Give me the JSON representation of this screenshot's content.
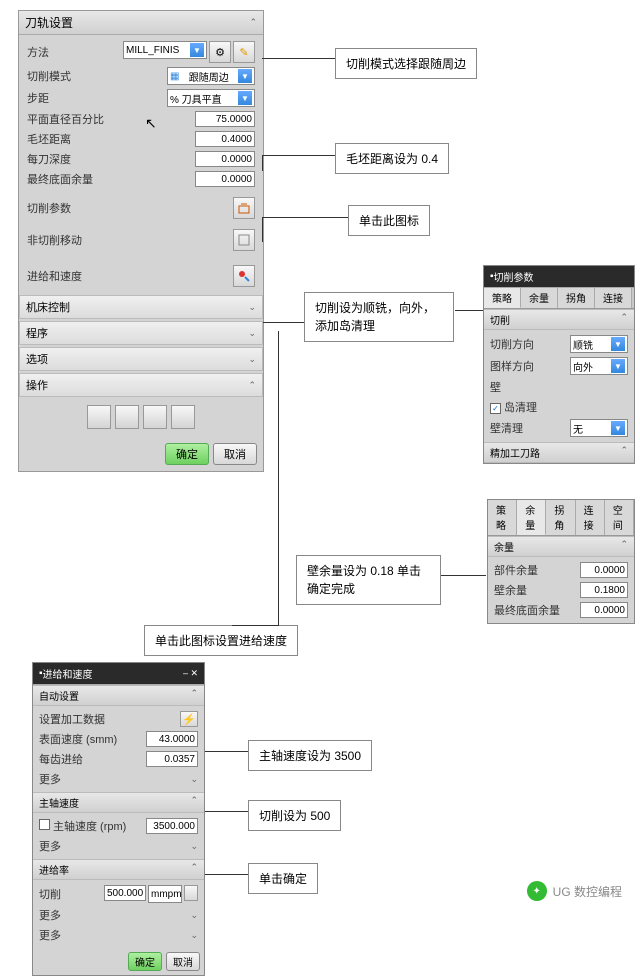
{
  "main": {
    "title": "刀轨设置",
    "method_label": "方法",
    "method_value": "MILL_FINIS",
    "cutmode_label": "切削模式",
    "cutmode_value": "跟随周边",
    "step_label": "步距",
    "step_value": "% 刀具平直",
    "plane_label": "平面直径百分比",
    "plane_value": "75.0000",
    "blank_label": "毛坯距离",
    "blank_value": "0.4000",
    "depth_label": "每刀深度",
    "depth_value": "0.0000",
    "bottom_label": "最终底面余量",
    "bottom_value": "0.0000",
    "cutparam_label": "切削参数",
    "noncut_label": "非切削移动",
    "feed_label": "进给和速度",
    "sec_machine": "机床控制",
    "sec_prog": "程序",
    "sec_option": "选项",
    "sec_op": "操作",
    "ok": "确定",
    "cancel": "取消"
  },
  "callouts": {
    "c1": "切削模式选择跟随周边",
    "c2": "毛坯距离设为 0.4",
    "c3": "单击此图标",
    "c4": "切削设为顺铣，向外，添加岛清理",
    "c5": "壁余量设为 0.18 单击确定完成",
    "c6": "单击此图标设置进给速度",
    "c7": "主轴速度设为 3500",
    "c8": "切削设为 500",
    "c9": "单击确定"
  },
  "cutpanel": {
    "title": "切削参数",
    "tab1": "策略",
    "tab2": "余量",
    "tab3": "拐角",
    "tab4": "连接",
    "tab5": "空间",
    "sec": "切削",
    "dir_label": "切削方向",
    "dir_value": "顺铣",
    "pat_label": "图样方向",
    "pat_value": "向外",
    "wall": "壁",
    "island": "岛清理",
    "clean_label": "壁清理",
    "clean_value": "无",
    "finish": "精加工刀路"
  },
  "stockpanel": {
    "tab2": "余量",
    "sec": "余量",
    "row1_label": "部件余量",
    "row1_value": "0.0000",
    "row2_label": "壁余量",
    "row2_value": "0.1800",
    "row3_label": "最终底面余量",
    "row3_value": "0.0000"
  },
  "feedpanel": {
    "title": "进给和速度",
    "auto": "自动设置",
    "set_label": "设置加工数据",
    "surf_label": "表面速度 (smm)",
    "surf_value": "43.0000",
    "feed_tooth": "每齿进给",
    "feed_tooth_value": "0.0357",
    "more1": "更多",
    "spindle_sec": "主轴速度",
    "spindle_label": "主轴速度 (rpm)",
    "spindle_value": "3500.000",
    "more2": "更多",
    "feedrate_sec": "进给率",
    "cut_label": "切削",
    "cut_value": "500.0000",
    "cut_unit": "mmpm",
    "more3": "更多",
    "more4": "更多",
    "ok": "确定",
    "cancel": "取消"
  },
  "watermark": "UG 数控编程"
}
